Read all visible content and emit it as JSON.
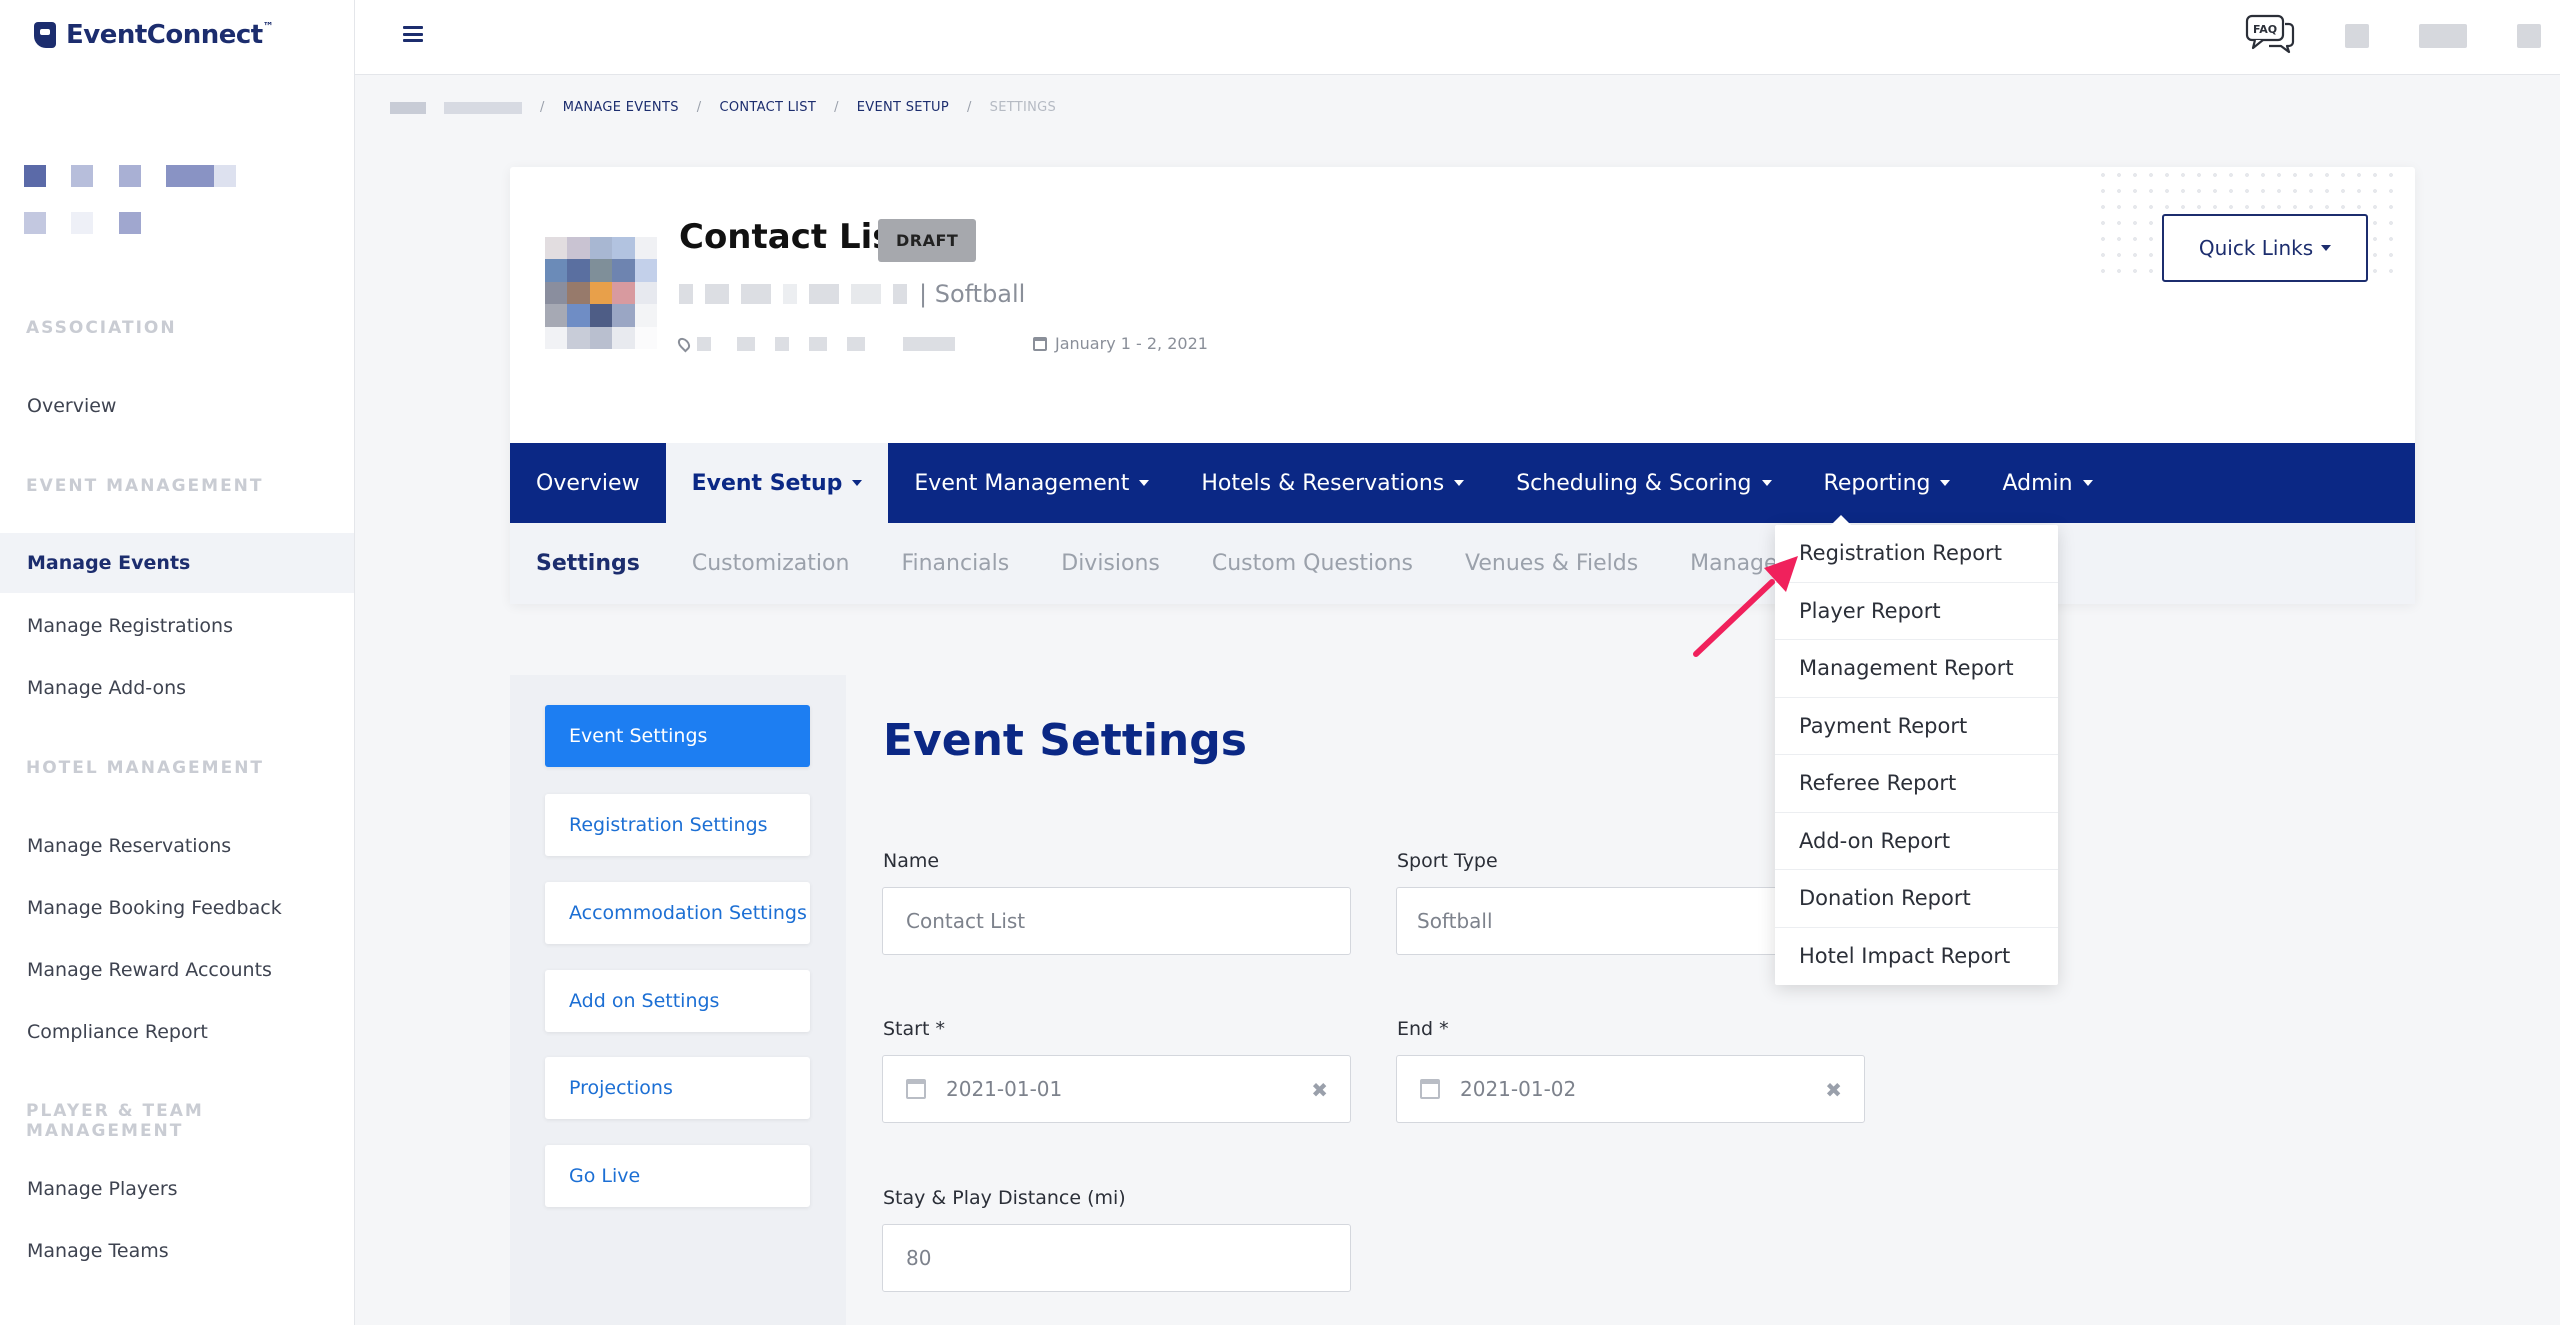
{
  "app": {
    "brand": "EventConnect",
    "trademark": "™"
  },
  "colors": {
    "brand_navy": "#0b2885",
    "accent_blue": "#1d7ef2",
    "annotation_pink": "#f0215c"
  },
  "sidebar": {
    "sections": [
      {
        "label": "ASSOCIATION",
        "items": [
          "Overview"
        ]
      },
      {
        "label": "EVENT MANAGEMENT",
        "items": [
          "Manage Events",
          "Manage Registrations",
          "Manage Add-ons"
        ]
      },
      {
        "label": "HOTEL MANAGEMENT",
        "items": [
          "Manage Reservations",
          "Manage Booking Feedback",
          "Manage Reward Accounts",
          "Compliance Report"
        ]
      },
      {
        "label": "PLAYER & TEAM MANAGEMENT",
        "items": [
          "Manage Players",
          "Manage Teams"
        ]
      }
    ],
    "active_item": "Manage Events"
  },
  "topbar": {
    "faq_label": "FAQ"
  },
  "breadcrumb": [
    "MANAGE EVENTS",
    "CONTACT LIST",
    "EVENT SETUP",
    "SETTINGS"
  ],
  "breadcrumb_sep": "/",
  "event": {
    "title": "Contact List",
    "status_badge": "DRAFT",
    "sport": "| Softball",
    "dates": "January 1 - 2, 2021",
    "quick_links": "Quick Links"
  },
  "main_nav": [
    {
      "label": "Overview",
      "has_caret": false
    },
    {
      "label": "Event Setup",
      "has_caret": true
    },
    {
      "label": "Event Management",
      "has_caret": true
    },
    {
      "label": "Hotels & Reservations",
      "has_caret": true
    },
    {
      "label": "Scheduling & Scoring",
      "has_caret": true
    },
    {
      "label": "Reporting",
      "has_caret": true
    },
    {
      "label": "Admin",
      "has_caret": true
    }
  ],
  "main_nav_active": "Event Setup",
  "sub_nav": [
    "Settings",
    "Customization",
    "Financials",
    "Divisions",
    "Custom Questions",
    "Venues & Fields",
    "Manage Users"
  ],
  "sub_nav_active": "Settings",
  "settings_menu": [
    "Event Settings",
    "Registration Settings",
    "Accommodation Settings",
    "Add on Settings",
    "Projections",
    "Go Live"
  ],
  "settings_menu_active": "Event Settings",
  "form": {
    "title": "Event Settings",
    "name_label": "Name",
    "name_value": "Contact List",
    "sport_label": "Sport Type",
    "sport_value": "Softball",
    "start_label": "Start *",
    "start_value": "2021-01-01",
    "end_label": "End *",
    "end_value": "2021-01-02",
    "distance_label": "Stay & Play Distance (mi)",
    "distance_value": "80",
    "clear_glyph": "✖"
  },
  "reporting_dropdown": [
    "Registration Report",
    "Player Report",
    "Management Report",
    "Payment Report",
    "Referee Report",
    "Add-on Report",
    "Donation Report",
    "Hotel Impact Report"
  ]
}
